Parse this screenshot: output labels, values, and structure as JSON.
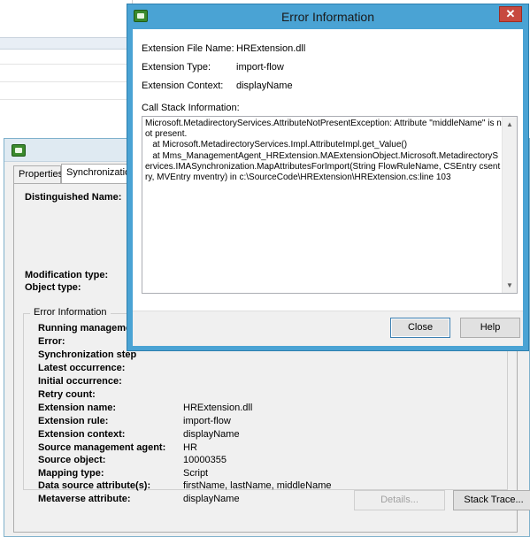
{
  "properties_window": {
    "tabs": [
      "Properties",
      "Synchronization"
    ],
    "fields": {
      "distinguished_name_label": "Distinguished Name:",
      "modification_type_label": "Modification type:",
      "object_type_label": "Object type:"
    },
    "error_group_title": "Error Information",
    "error_rows": [
      {
        "label": "Running manageme",
        "value": ""
      },
      {
        "label": "Error:",
        "value": ""
      },
      {
        "label": "Synchronization step",
        "value": ""
      },
      {
        "label": "Latest occurrence:",
        "value": ""
      },
      {
        "label": "Initial occurrence:",
        "value": ""
      },
      {
        "label": "Retry count:",
        "value": ""
      },
      {
        "label": "Extension name:",
        "value": "HRExtension.dll"
      },
      {
        "label": "Extension rule:",
        "value": "import-flow"
      },
      {
        "label": "Extension context:",
        "value": "displayName"
      },
      {
        "label": "Source management agent:",
        "value": "HR"
      },
      {
        "label": "Source object:",
        "value": "10000355"
      },
      {
        "label": "Mapping type:",
        "value": "Script"
      },
      {
        "label": "Data source attribute(s):",
        "value": "firstName, lastName, middleName"
      },
      {
        "label": "Metaverse attribute:",
        "value": "displayName"
      }
    ],
    "buttons": {
      "details": "Details...",
      "stack_trace": "Stack Trace..."
    }
  },
  "error_dialog": {
    "title": "Error Information",
    "close_glyph": "✕",
    "extension_file_name_label": "Extension File Name:",
    "extension_file_name": "HRExtension.dll",
    "extension_type_label": "Extension Type:",
    "extension_type": "import-flow",
    "extension_context_label": "Extension Context:",
    "extension_context": "displayName",
    "call_stack_label": "Call Stack Information:",
    "call_stack": "Microsoft.MetadirectoryServices.AttributeNotPresentException: Attribute \"middleName\" is not present.\n   at Microsoft.MetadirectoryServices.Impl.AttributeImpl.get_Value()\n   at Mms_ManagementAgent_HRExtension.MAExtensionObject.Microsoft.MetadirectoryServices.IMASynchronization.MapAttributesForImport(String FlowRuleName, CSEntry csentry, MVEntry mventry) in c:\\SourceCode\\HRExtension\\HRExtension.cs:line 103",
    "buttons": {
      "close": "Close",
      "help": "Help"
    }
  },
  "colors": {
    "dialog_frame": "#4aa3d4",
    "close_button": "#c7493f",
    "panel_background": "#f0f0f0"
  },
  "icons": {
    "app_icon": "sync-app-icon",
    "scroll_up": "▲",
    "scroll_down": "▼"
  }
}
